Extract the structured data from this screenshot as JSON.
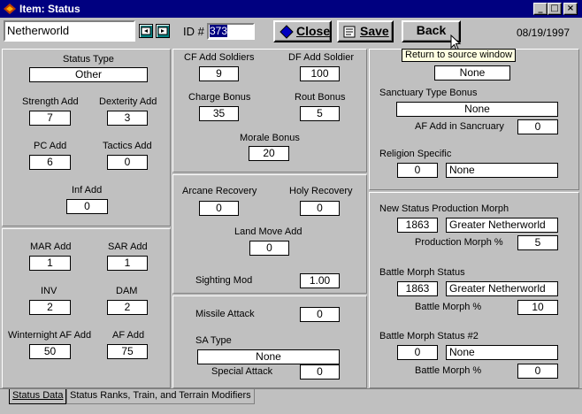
{
  "window": {
    "title": "Item: Status"
  },
  "header": {
    "name_value": "Netherworld",
    "id_label": "ID #",
    "id_value": "373",
    "close_label": "Close",
    "save_label": "Save",
    "back_label": "Back",
    "date": "08/19/1997",
    "tooltip": "Return to source window"
  },
  "col1": {
    "status_type_label": "Status Type",
    "status_type_value": "Other",
    "strength_label": "Strength Add",
    "strength_value": "7",
    "dexterity_label": "Dexterity Add",
    "dexterity_value": "3",
    "pc_label": "PC Add",
    "pc_value": "6",
    "tactics_label": "Tactics Add",
    "tactics_value": "0",
    "inf_label": "Inf Add",
    "inf_value": "0",
    "mar_label": "MAR Add",
    "mar_value": "1",
    "sar_label": "SAR Add",
    "sar_value": "1",
    "inv_label": "INV",
    "inv_value": "2",
    "dam_label": "DAM",
    "dam_value": "2",
    "winter_label": "Winternight AF Add",
    "winter_value": "50",
    "af_label": "AF Add",
    "af_value": "75"
  },
  "col2": {
    "cf_label": "CF Add Soldiers",
    "cf_value": "9",
    "df_label": "DF Add Soldier",
    "df_value": "100",
    "charge_label": "Charge Bonus",
    "charge_value": "35",
    "rout_label": "Rout Bonus",
    "rout_value": "5",
    "morale_label": "Morale Bonus",
    "morale_value": "20",
    "arcane_label": "Arcane Recovery",
    "arcane_value": "0",
    "holy_label": "Holy Recovery",
    "holy_value": "0",
    "landmove_label": "Land Move Add",
    "landmove_value": "0",
    "sighting_label": "Sighting Mod",
    "sighting_value": "1.00",
    "missile_label": "Missile Attack",
    "missile_value": "0",
    "satype_label": "SA Type",
    "satype_value": "None",
    "special_label": "Special Attack",
    "special_value": "0"
  },
  "col3": {
    "top_partial_label": "...",
    "top_value": "None",
    "sanctuary_label": "Sanctuary Type Bonus",
    "sanctuary_value": "None",
    "afsanct_label": "AF Add in Sancruary",
    "afsanct_value": "0",
    "religion_label": "Religion Specific",
    "religion_id": "0",
    "religion_name": "None",
    "newprod_label": "New Status Production Morph",
    "newprod_id": "1863",
    "newprod_name": "Greater Netherworld",
    "prodpct_label": "Production Morph %",
    "prodpct_value": "5",
    "battle_label": "Battle Morph Status",
    "battle_id": "1863",
    "battle_name": "Greater Netherworld",
    "battlepct_label": "Battle Morph %",
    "battlepct_value": "10",
    "battle2_label": "Battle Morph Status #2",
    "battle2_id": "0",
    "battle2_name": "None",
    "battle2pct_label": "Battle Morph %",
    "battle2pct_value": "0"
  },
  "tabs": [
    "Status Data",
    "Status Ranks, Train, and Terrain Modifiers"
  ]
}
